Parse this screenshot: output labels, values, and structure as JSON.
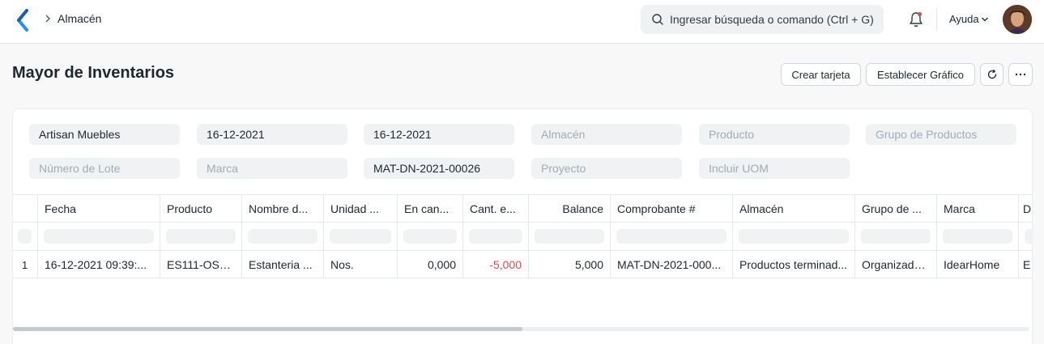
{
  "breadcrumb": {
    "item": "Almacén"
  },
  "search": {
    "placeholder": "Ingresar búsqueda o comando (Ctrl + G)"
  },
  "navbar": {
    "help_label": "Ayuda"
  },
  "page": {
    "title": "Mayor de Inventarios"
  },
  "actions": {
    "create_card": "Crear tarjeta",
    "set_chart": "Establecer Gráfico"
  },
  "filters": {
    "company": "Artisan Muebles",
    "from_date": "16-12-2021",
    "to_date": "16-12-2021",
    "warehouse": "Almacén",
    "item": "Producto",
    "item_group": "Grupo de Productos",
    "batch": "Número de Lote",
    "brand": "Marca",
    "voucher": "MAT-DN-2021-00026",
    "project": "Proyecto",
    "include_uom": "Incluir UOM"
  },
  "table": {
    "columns": [
      "Fecha",
      "Producto",
      "Nombre d...",
      "Unidad ...",
      "En can...",
      "Cant. e...",
      "Balance",
      "Comprobante #",
      "Almacén",
      "Grupo de ...",
      "Marca",
      "D"
    ],
    "rows": [
      {
        "index": "1",
        "cells": [
          "16-12-2021 09:39:...",
          "ES111-OSC...",
          "Estanteria ...",
          "Nos.",
          "0,000",
          "-5,000",
          "5,000",
          "MAT-DN-2021-000...",
          "Productos terminad...",
          "Organizador...",
          "IdearHome",
          "E"
        ]
      }
    ]
  },
  "colors": {
    "negative": "#e24c4c",
    "accent": "#2490ef"
  }
}
